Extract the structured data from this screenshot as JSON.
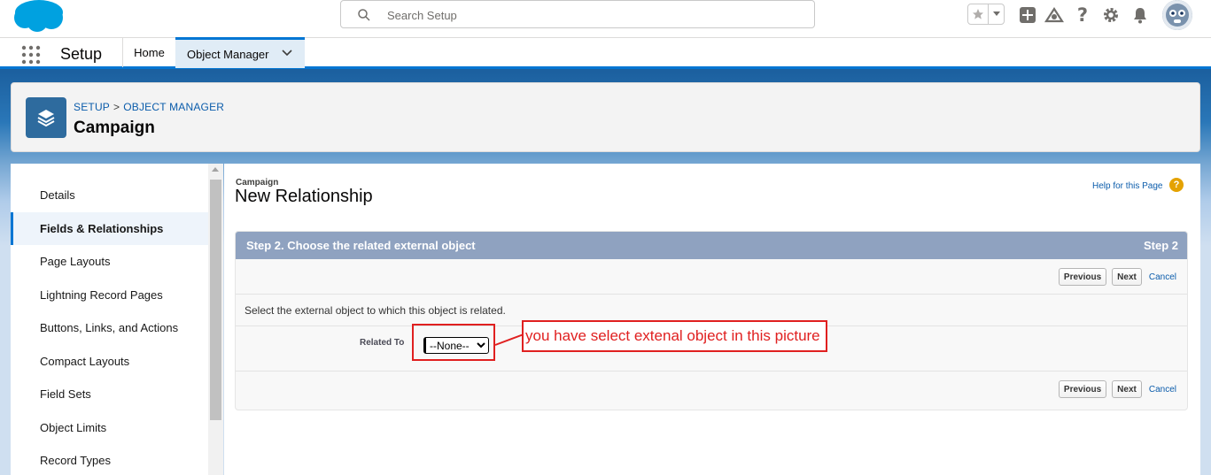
{
  "header": {
    "search_placeholder": "Search Setup",
    "icons": [
      "favorites-star-icon",
      "add-icon",
      "trailhead-icon",
      "help-icon",
      "gear-icon",
      "notifications-bell-icon",
      "avatar"
    ]
  },
  "nav": {
    "app_name": "Setup",
    "tabs": [
      {
        "label": "Home"
      },
      {
        "label": "Object Manager"
      }
    ]
  },
  "object_header": {
    "breadcrumb": [
      "SETUP",
      "OBJECT MANAGER"
    ],
    "breadcrumb_separator": ">",
    "title": "Campaign"
  },
  "sidebar": {
    "items": [
      {
        "label": "Details"
      },
      {
        "label": "Fields & Relationships",
        "active": true
      },
      {
        "label": "Page Layouts"
      },
      {
        "label": "Lightning Record Pages"
      },
      {
        "label": "Buttons, Links, and Actions"
      },
      {
        "label": "Compact Layouts"
      },
      {
        "label": "Field Sets"
      },
      {
        "label": "Object Limits"
      },
      {
        "label": "Record Types"
      }
    ]
  },
  "content": {
    "subtitle": "Campaign",
    "title": "New Relationship",
    "help_link": "Help for this Page",
    "help_icon": "?",
    "step_title": "Step 2. Choose the related external object",
    "step_number": "Step 2",
    "buttons": {
      "previous": "Previous",
      "next": "Next",
      "cancel": "Cancel"
    },
    "instruction": "Select the external object to which this object is related.",
    "related_label": "Related To",
    "related_value": "--None--"
  },
  "annotation": {
    "text": "you have select extenal object in this picture",
    "color": "#e02020"
  },
  "colors": {
    "brand_blue": "#0176d3",
    "step_header": "#8fa2c0",
    "object_icon": "#2e6b9e"
  }
}
